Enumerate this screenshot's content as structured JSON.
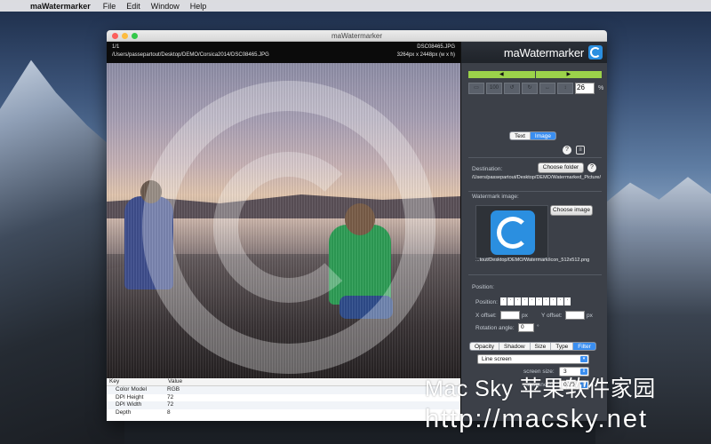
{
  "menubar": {
    "apple": "",
    "app_name": "maWatermarker",
    "items": [
      "File",
      "Edit",
      "Window",
      "Help"
    ]
  },
  "window": {
    "title": "maWatermarker"
  },
  "info": {
    "counter": "1/1",
    "path": "/Users/passepartout/Desktop/DEMO/Corsica2014/DSC08465.JPG",
    "filename": "DSC08465.JPG",
    "dimensions": "3264px x 2448px (w x h)"
  },
  "metadata": {
    "headers": [
      "Key",
      "Value"
    ],
    "rows": [
      {
        "key": "Color Model",
        "value": "RGB"
      },
      {
        "key": "DPI Height",
        "value": "72"
      },
      {
        "key": "DPI Width",
        "value": "72"
      },
      {
        "key": "Depth",
        "value": "8"
      }
    ]
  },
  "panel": {
    "brand": "maWatermarker",
    "prev": "◀",
    "next": "▶",
    "tools": [
      "▭",
      "100",
      "↺",
      "↻",
      "↔",
      "↕"
    ],
    "zoom_value": "26",
    "zoom_unit": "%",
    "mode_tabs": [
      {
        "label": "Text",
        "active": false
      },
      {
        "label": "Image",
        "active": true
      }
    ],
    "help": "?",
    "destination_label": "Destination:",
    "choose_folder": "Choose folder",
    "destination_path": "/Users/passepartout/Desktop/DEMO/Watermarked_Picture/",
    "watermark_image_label": "Watermark image:",
    "choose_image": "Choose image",
    "image_path": "...tout/Desktop/DEMO/Watermark/icon_512x512.png",
    "position_label": "Position:",
    "position_field": "Position:",
    "x_offset_label": "X offset:",
    "y_offset_label": "Y offset:",
    "offset_unit": "px",
    "rotation_label": "Rotation angle:",
    "rotation_value": "0",
    "rotation_unit": "°",
    "filter_tabs": [
      {
        "label": "Opacity",
        "active": false
      },
      {
        "label": "Shadow",
        "active": false
      },
      {
        "label": "Size",
        "active": false
      },
      {
        "label": "Type",
        "active": false
      },
      {
        "label": "Filter",
        "active": true
      }
    ],
    "filter_select": "Line screen",
    "screen_size_label": "screen size:",
    "screen_size_value": "3",
    "sharpness_label": "sharpness:",
    "sharpness_value": "0.70"
  },
  "site_watermark": {
    "line1": "Mac Sky 苹果软件家园",
    "line2": "http://macsky.net"
  }
}
